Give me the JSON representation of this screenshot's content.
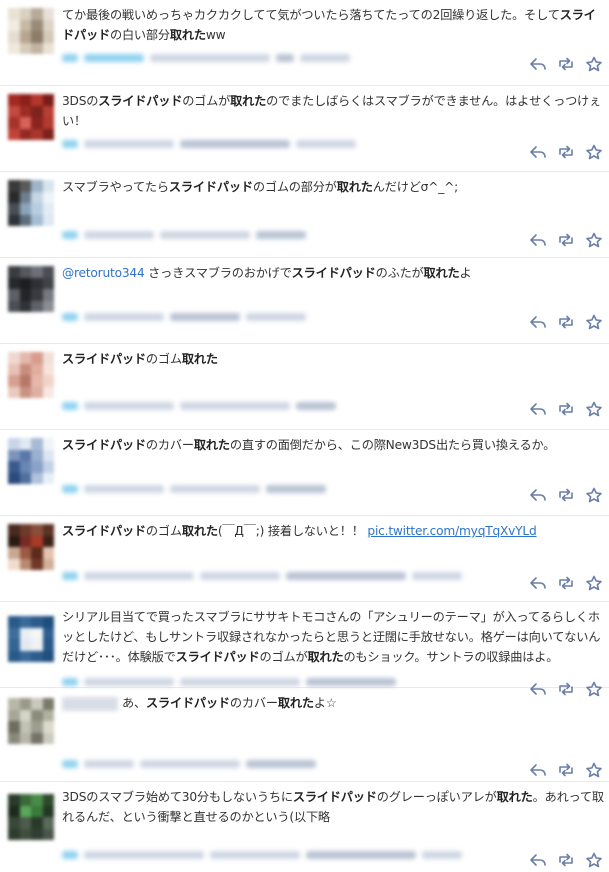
{
  "tweets": [
    {
      "segments": [
        {
          "t": "てか最後の戦いめっちゃカクカクしてて気がついたら落ちてたっての2回繰り返した。そして",
          "b": false
        },
        {
          "t": "スライドパッド",
          "b": true
        },
        {
          "t": "の白い部分",
          "b": false
        },
        {
          "t": "取れた",
          "b": true
        },
        {
          "t": "ww",
          "b": false
        }
      ],
      "avatar_colors": [
        "#e8e2d4",
        "#d8d0c0",
        "#b8aa98",
        "#e6e0d8",
        "#f0ece2",
        "#c8b8a4",
        "#9a8a78",
        "#ddd4c6",
        "#e4ddd0",
        "#b7a591",
        "#8d7c6a",
        "#d4c9b8",
        "#efe9dd",
        "#d6cbbb",
        "#c2b4a2",
        "#e9e2d6"
      ]
    },
    {
      "segments": [
        {
          "t": "3DSの",
          "b": false
        },
        {
          "t": "スライドパッド",
          "b": true
        },
        {
          "t": "のゴムが",
          "b": false
        },
        {
          "t": "取れた",
          "b": true
        },
        {
          "t": "のでまたしばらくはスマブラができません。はよせくっつけぇい！",
          "b": false
        }
      ],
      "avatar_colors": [
        "#a22a22",
        "#8c1f1a",
        "#b5362d",
        "#7a1c18",
        "#c24a3e",
        "#9e2c24",
        "#7d231e",
        "#b83e33",
        "#a6332a",
        "#d6625a",
        "#8a241e",
        "#b33a30",
        "#c14338",
        "#932a22",
        "#a8362c",
        "#7c201a"
      ]
    },
    {
      "segments": [
        {
          "t": "スマブラやってたら",
          "b": false
        },
        {
          "t": "スライドパッド",
          "b": true
        },
        {
          "t": "のゴムの部分が",
          "b": false
        },
        {
          "t": "取れた",
          "b": true
        },
        {
          "t": "んだけどσ^_^;",
          "b": false
        }
      ],
      "avatar_colors": [
        "#3a3a3a",
        "#5a5a5a",
        "#9fb4c8",
        "#d8e4ee",
        "#2a2a2a",
        "#6d7f90",
        "#c4d6e4",
        "#eef4f8",
        "#4a4f55",
        "#8aa4bb",
        "#b9cde0",
        "#e2ecf4",
        "#2f3338",
        "#5d6e7e",
        "#a5bdd2",
        "#dce8f2"
      ]
    },
    {
      "mention": "@retoruto344",
      "segments": [
        {
          "t": " さっきスマブラのおかげで",
          "b": false
        },
        {
          "t": "スライドパッド",
          "b": true
        },
        {
          "t": "のふたが",
          "b": false
        },
        {
          "t": "取れた",
          "b": true
        },
        {
          "t": "よ",
          "b": false
        }
      ],
      "avatar_colors": [
        "#3a3c40",
        "#55585e",
        "#6d7076",
        "#4a4d52",
        "#26282c",
        "#1c1e21",
        "#2e3034",
        "#404347",
        "#5c6066",
        "#222428",
        "#383b40",
        "#76797f",
        "#4b4e53",
        "#303338",
        "#5f6369",
        "#8a8d92"
      ]
    },
    {
      "segments": [
        {
          "t": "スライドパッド",
          "b": true
        },
        {
          "t": "のゴム",
          "b": false
        },
        {
          "t": "取れた",
          "b": true
        }
      ],
      "avatar_colors": [
        "#f0d8d0",
        "#e4b8ac",
        "#d89c8c",
        "#f2e0d8",
        "#e8c2b6",
        "#c98d7e",
        "#e0ad9f",
        "#f4e4dc",
        "#d7a090",
        "#b7786a",
        "#e6b8aa",
        "#f0d4ca",
        "#e9cabd",
        "#c99282",
        "#ddb0a2",
        "#f6e8e2"
      ]
    },
    {
      "segments": [
        {
          "t": "スライドパッド",
          "b": true
        },
        {
          "t": "のカバー",
          "b": false
        },
        {
          "t": "取れた",
          "b": true
        },
        {
          "t": "の直すの面倒だから、この際New3DS出たら買い換えるか。",
          "b": false
        }
      ],
      "avatar_colors": [
        "#c8d4e8",
        "#e0e8f4",
        "#a8bad6",
        "#f0f4fa",
        "#7c94bc",
        "#5a78a8",
        "#9ab0d0",
        "#dce6f2",
        "#3a5a8e",
        "#6a86b4",
        "#8aa2c8",
        "#c4d2e6",
        "#2c4a7c",
        "#5070a0",
        "#b0c2dc",
        "#e8eef6"
      ]
    },
    {
      "segments": [
        {
          "t": "スライドパッド",
          "b": true
        },
        {
          "t": "のゴム",
          "b": false
        },
        {
          "t": "取れた",
          "b": true
        },
        {
          "t": "(￣Д￣;) 接着しないと！！ ",
          "b": false
        }
      ],
      "link": "pic.twitter.com/myqTqXvYLd",
      "avatar_colors": [
        "#4a2a1e",
        "#6c3a2a",
        "#8a4e3a",
        "#5a3222",
        "#2a1a12",
        "#7a2a20",
        "#a83a2a",
        "#3a2218",
        "#c8a890",
        "#9a5a44",
        "#5e2a1c",
        "#e2c4ae",
        "#f0dccc",
        "#b88a70",
        "#703828",
        "#d0b098"
      ]
    },
    {
      "segments": [
        {
          "t": "シリアル目当てで買ったスマブラにササキトモコさんの「アシュリーのテーマ」が入ってるらしくホッとしたけど、もしサントラ収録されなかったらと思うと迂闊に手放せない。格ゲーは向いてないんだけど･･･。体験版で",
          "b": false
        },
        {
          "t": "スライドパッド",
          "b": true
        },
        {
          "t": "のゴムが",
          "b": false
        },
        {
          "t": "取れた",
          "b": true
        },
        {
          "t": "のもショック。サントラの収録曲はよ。",
          "b": false
        }
      ],
      "avatar_colors": [
        "#2a5a8a",
        "#3a6a9a",
        "#2c5c8c",
        "#1e4e7e",
        "#3e6e9e",
        "#e8eef4",
        "#f4f6f8",
        "#2e5e8e",
        "#346494",
        "#e4eaf2",
        "#f0f2f6",
        "#285888",
        "#2a5a8a",
        "#3a6a9a",
        "#2c5c8c",
        "#204f80"
      ]
    },
    {
      "mention_blur": true,
      "segments": [
        {
          "t": "あ、",
          "b": false
        },
        {
          "t": "スライドパッド",
          "b": true
        },
        {
          "t": "のカバー",
          "b": false
        },
        {
          "t": "取れた",
          "b": true
        },
        {
          "t": "よ☆",
          "b": false
        }
      ],
      "avatar_colors": [
        "#b8b8a8",
        "#9a9a8a",
        "#c8c8bc",
        "#7a7a6a",
        "#a6a696",
        "#d4d4c8",
        "#8c8c7c",
        "#b2b2a2",
        "#6e6e60",
        "#c2c2b4",
        "#9e9e90",
        "#dadace",
        "#8a8a7c",
        "#b6b6a8",
        "#74746a",
        "#cacabe"
      ]
    },
    {
      "segments": [
        {
          "t": "3DSのスマブラ始めて30分もしないうちに",
          "b": false
        },
        {
          "t": "スライドパッド",
          "b": true
        },
        {
          "t": "のグレーっぽいアレが",
          "b": false
        },
        {
          "t": "取れた",
          "b": true
        },
        {
          "t": "。あれって取れるんだ、という衝撃と直せるのかという(以下略",
          "b": false
        }
      ],
      "avatar_colors": [
        "#2a3a2a",
        "#3a6a3a",
        "#4a8a4a",
        "#2e4a2e",
        "#1e2a1e",
        "#5aa65a",
        "#3a7a3a",
        "#263626",
        "#384838",
        "#4c5c4c",
        "#2a3a2a",
        "#5a6a5a",
        "#2e3e2e",
        "#404e40",
        "#323e32",
        "#4a564a"
      ]
    }
  ],
  "icons": [
    "reply-icon",
    "retweet-icon",
    "favorite-icon"
  ]
}
